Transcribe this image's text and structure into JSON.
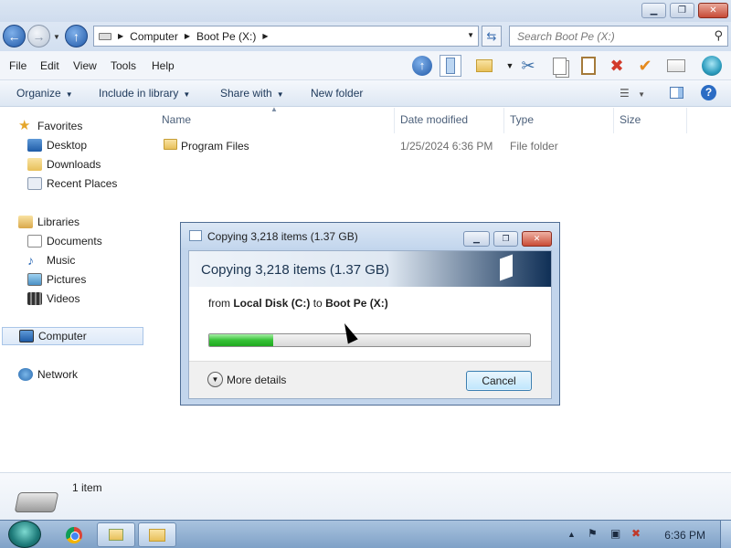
{
  "window": {
    "min_label": "▁",
    "max_label": "❐",
    "close_label": "✕"
  },
  "address": {
    "back_icon": "←",
    "forward_icon": "→",
    "up_icon": "↑",
    "crumbs": [
      "Computer",
      "Boot Pe (X:)"
    ],
    "search_placeholder": "Search Boot Pe (X:)"
  },
  "menu": [
    "File",
    "Edit",
    "View",
    "Tools",
    "Help"
  ],
  "toolbar_icons": [
    "up-arrow-icon",
    "layout-pane-icon",
    "properties-folder-icon",
    "scissors-icon",
    "copy-icon",
    "paste-icon",
    "delete-icon",
    "checkmark-icon",
    "mail-icon",
    "globe-icon"
  ],
  "commands": {
    "organize": "Organize",
    "include_in_library": "Include in library",
    "share_with": "Share with",
    "new_folder": "New folder"
  },
  "nav": {
    "favorites": "Favorites",
    "desktop": "Desktop",
    "downloads": "Downloads",
    "recent_places": "Recent Places",
    "libraries": "Libraries",
    "documents": "Documents",
    "music": "Music",
    "pictures": "Pictures",
    "videos": "Videos",
    "computer": "Computer",
    "network": "Network"
  },
  "columns": {
    "name": "Name",
    "date": "Date modified",
    "type": "Type",
    "size": "Size"
  },
  "files": [
    {
      "name": "Program Files",
      "date": "1/25/2024 6:36 PM",
      "type": "File folder",
      "size": ""
    }
  ],
  "details": {
    "count": "1 item"
  },
  "dialog": {
    "title": "Copying 3,218 items (1.37 GB)",
    "heading": "Copying 3,218 items (1.37 GB)",
    "from_word": "from",
    "source": "Local Disk (C:)",
    "to_word": "to",
    "destination": "Boot Pe (X:)",
    "progress_fraction": 0.2,
    "more_details": "More details",
    "cancel": "Cancel"
  },
  "taskbar": {
    "clock": "6:36 PM"
  }
}
